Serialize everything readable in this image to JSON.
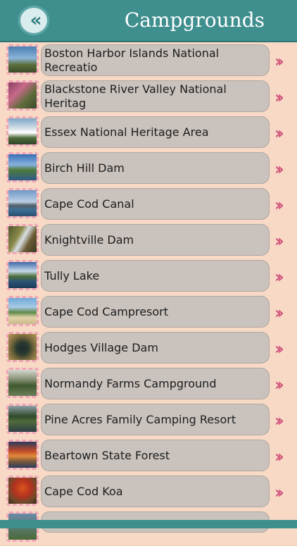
{
  "header": {
    "title": "Campgrounds",
    "back_icon": "double-chevron-left-icon"
  },
  "colors": {
    "header_bg": "#3f8f8e",
    "page_bg": "#f7d9c6",
    "pill_bg": "#c9c2bd",
    "chevron": "#d2597f",
    "thumb_border": "#f0a6b6"
  },
  "items": [
    {
      "label": "Boston Harbor Islands National Recreatio",
      "thumb": "lighthouse-photo"
    },
    {
      "label": "Blackstone River Valley National Heritag",
      "thumb": "river-flowers-photo"
    },
    {
      "label": "Essex National Heritage Area",
      "thumb": "town-photo"
    },
    {
      "label": "Birch Hill Dam",
      "thumb": "lake-photo"
    },
    {
      "label": "Cape Cod Canal",
      "thumb": "bridge-photo"
    },
    {
      "label": "Knightville Dam",
      "thumb": "forest-stream-photo"
    },
    {
      "label": "Tully Lake",
      "thumb": "lake-clouds-photo"
    },
    {
      "label": "Cape Cod Campresort",
      "thumb": "beach-photo"
    },
    {
      "label": "Hodges Village Dam",
      "thumb": "aerial-forest-photo"
    },
    {
      "label": "Normandy Farms Campground",
      "thumb": "campground-photo"
    },
    {
      "label": "Pine Acres Family Camping Resort",
      "thumb": "pine-lake-photo"
    },
    {
      "label": "Beartown State Forest",
      "thumb": "autumn-lake-photo"
    },
    {
      "label": "Cape Cod Koa",
      "thumb": "autumn-tree-photo"
    },
    {
      "label": "",
      "thumb": "partial-photo"
    }
  ],
  "chevron_icon": "double-chevron-right-icon"
}
